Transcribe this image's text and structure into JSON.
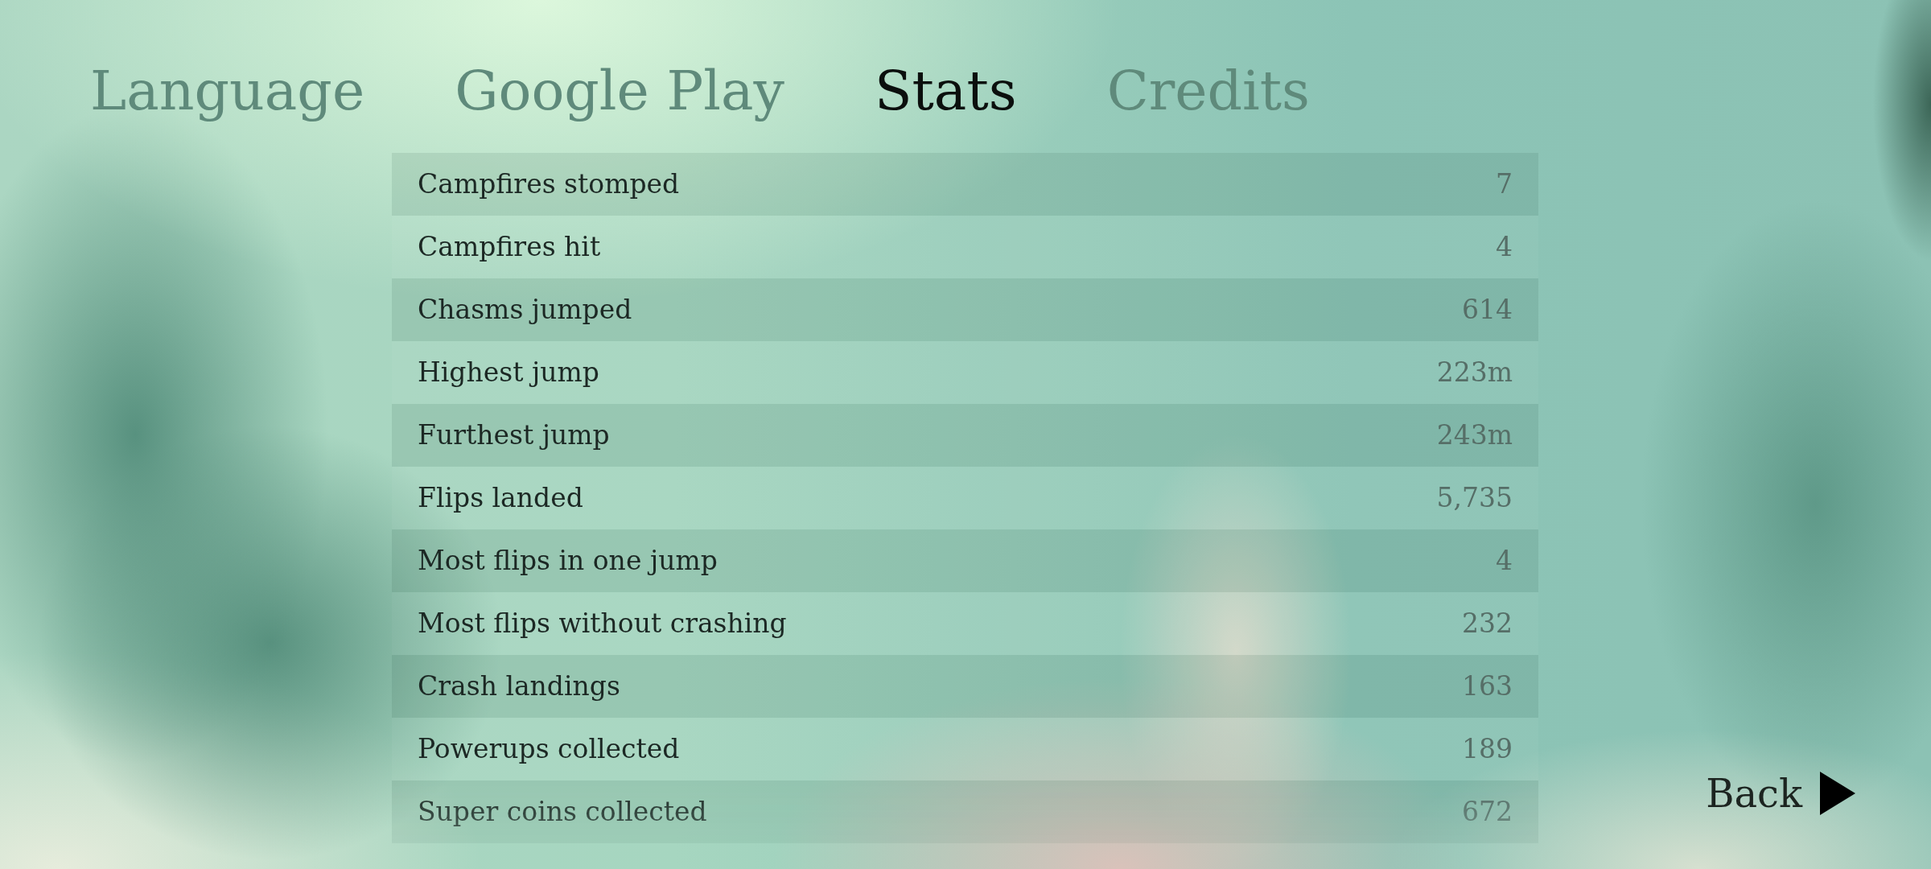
{
  "tabs": [
    {
      "label": "Language",
      "selected": false
    },
    {
      "label": "Google Play",
      "selected": false
    },
    {
      "label": "Stats",
      "selected": true
    },
    {
      "label": "Credits",
      "selected": false
    }
  ],
  "stats": [
    {
      "name": "Campfires stomped",
      "value": "7"
    },
    {
      "name": "Campfires hit",
      "value": "4"
    },
    {
      "name": "Chasms jumped",
      "value": "614"
    },
    {
      "name": "Highest jump",
      "value": "223m"
    },
    {
      "name": "Furthest jump",
      "value": "243m"
    },
    {
      "name": "Flips landed",
      "value": "5,735"
    },
    {
      "name": "Most flips in one jump",
      "value": "4"
    },
    {
      "name": "Most flips without crashing",
      "value": "232"
    },
    {
      "name": "Crash landings",
      "value": "163"
    },
    {
      "name": "Powerups collected",
      "value": "189"
    },
    {
      "name": "Super coins collected",
      "value": "672"
    }
  ],
  "back_button": {
    "label": "Back"
  }
}
